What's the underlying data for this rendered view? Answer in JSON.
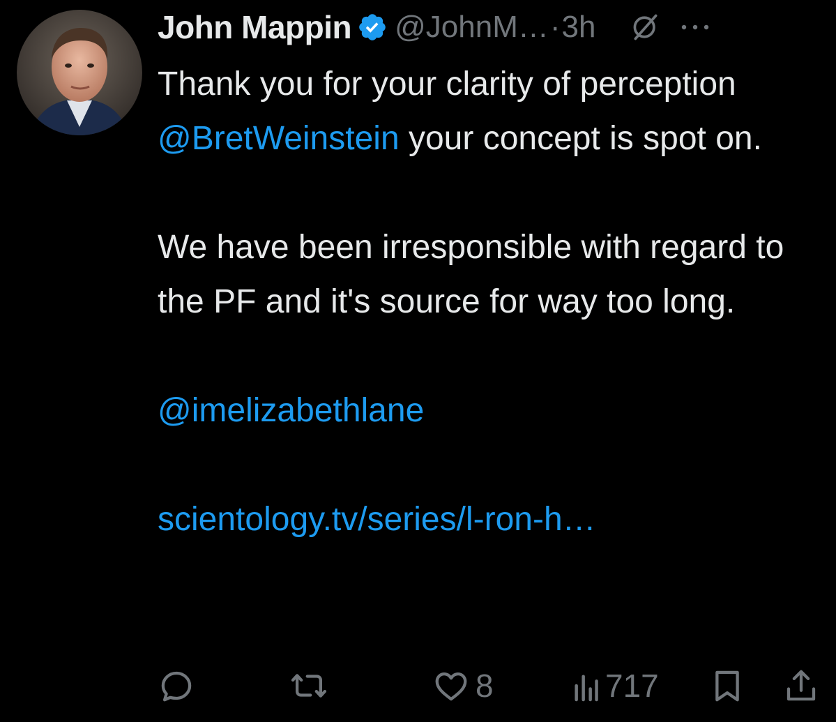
{
  "tweet": {
    "author": {
      "name": "John Mappin",
      "handle": "@JohnM…",
      "verified": true
    },
    "separator": "·",
    "time": "3h",
    "body": {
      "p1_a": "Thank you for your clarity of perception ",
      "p1_mention": "@BretWeinstein",
      "p1_b": " your concept is spot on.",
      "p2": "We have been irresponsible with regard to the PF and it's source for way too long.",
      "p3_mention": "@imelizabethlane",
      "p4_link": "scientology.tv/series/l-ron-h…"
    },
    "actions": {
      "reply_count": "",
      "retweet_count": "",
      "like_count": "8",
      "views_count": "717"
    }
  },
  "icons": {
    "verified": "verified-badge-icon",
    "grok": "grok-icon",
    "more": "more-icon",
    "reply": "reply-icon",
    "retweet": "retweet-icon",
    "like": "heart-icon",
    "views": "views-icon",
    "bookmark": "bookmark-icon",
    "share": "share-icon"
  },
  "colors": {
    "background": "#000000",
    "text": "#e7e9ea",
    "muted": "#71767b",
    "link": "#1d9bf0"
  }
}
